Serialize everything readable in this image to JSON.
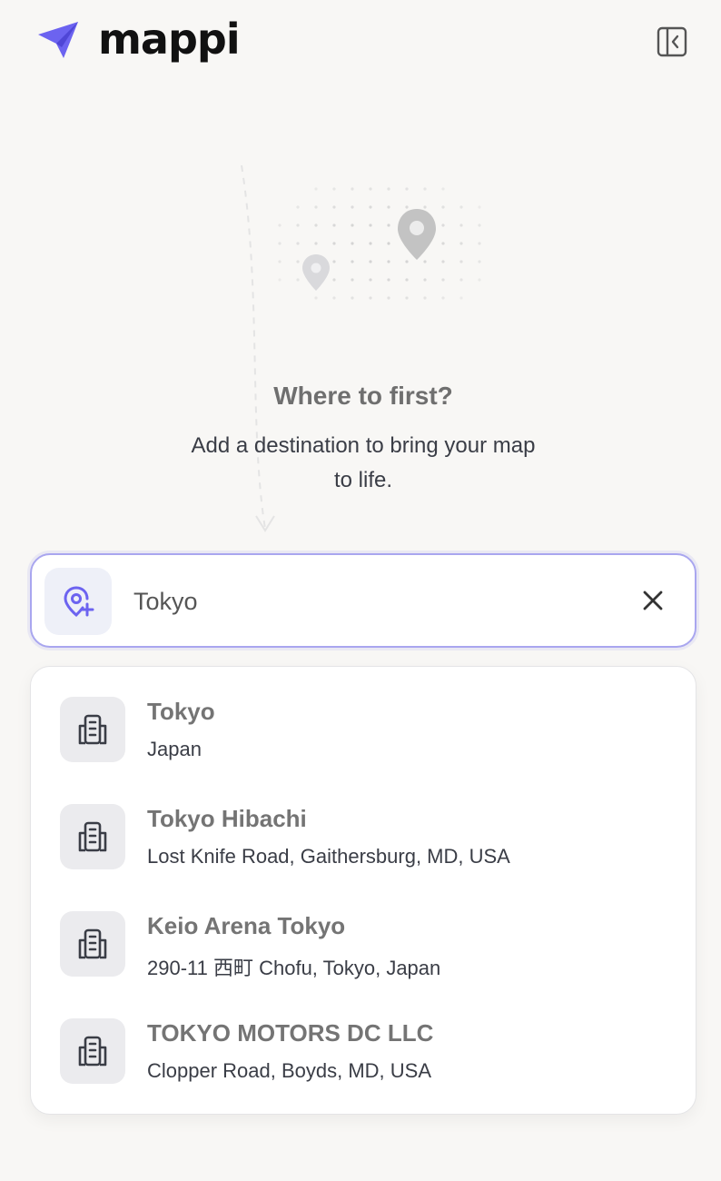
{
  "header": {
    "brand_name": "mappi",
    "brand_color": "#6c63f0"
  },
  "empty_state": {
    "title": "Where to first?",
    "subtitle": "Add a destination to bring your map to life."
  },
  "search": {
    "value": "Tokyo",
    "placeholder": "",
    "accent_color": "#a9a6ef",
    "icon": "location-add-icon"
  },
  "results": [
    {
      "title": "Tokyo",
      "subtitle": "Japan",
      "icon": "building-icon"
    },
    {
      "title": "Tokyo Hibachi",
      "subtitle": "Lost Knife Road, Gaithersburg, MD, USA",
      "icon": "building-icon"
    },
    {
      "title": "Keio Arena Tokyo",
      "subtitle": "290-11 西町 Chofu, Tokyo, Japan",
      "icon": "building-icon"
    },
    {
      "title": "TOKYO MOTORS DC LLC",
      "subtitle": "Clopper Road, Boyds, MD, USA",
      "icon": "building-icon"
    }
  ]
}
